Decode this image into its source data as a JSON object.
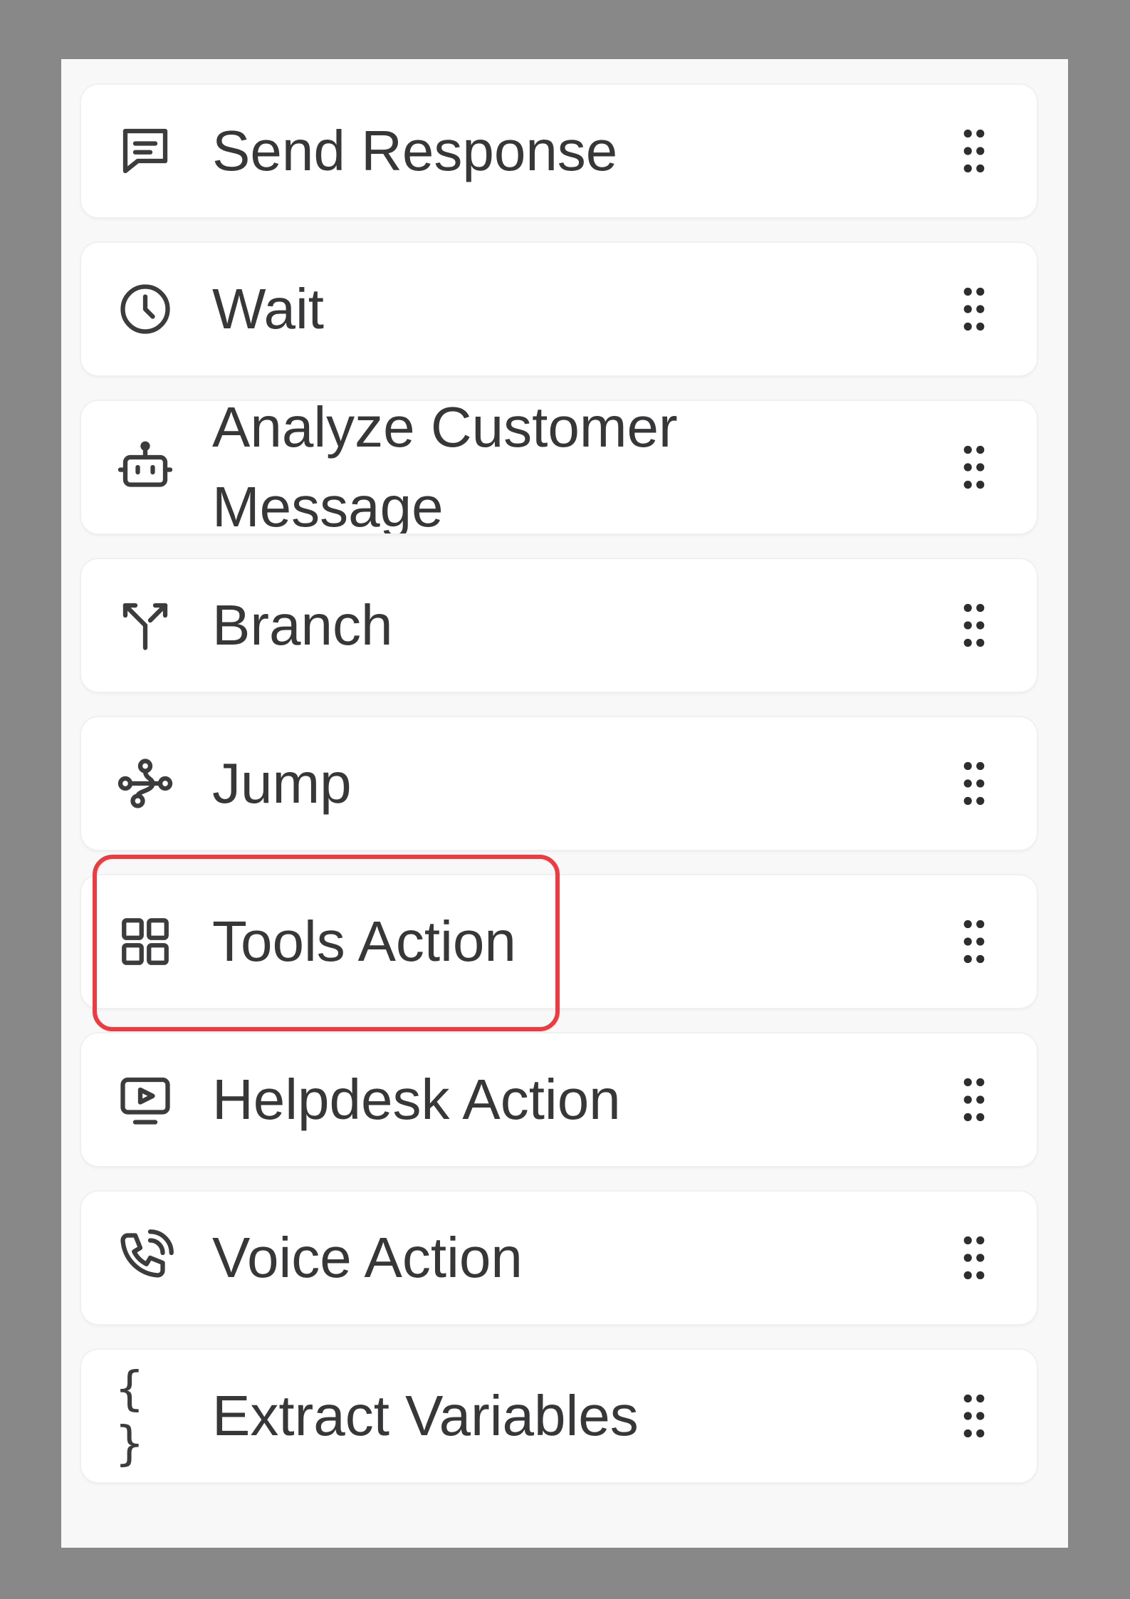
{
  "actions": [
    {
      "label": "Send Response",
      "icon": "message-square-icon"
    },
    {
      "label": "Wait",
      "icon": "clock-icon"
    },
    {
      "label": "Analyze Customer Message",
      "icon": "bot-icon"
    },
    {
      "label": "Branch",
      "icon": "split-icon"
    },
    {
      "label": "Jump",
      "icon": "workflow-icon"
    },
    {
      "label": "Tools Action",
      "icon": "grid-icon"
    },
    {
      "label": "Helpdesk Action",
      "icon": "monitor-play-icon"
    },
    {
      "label": "Voice Action",
      "icon": "phone-call-icon"
    },
    {
      "label": "Extract Variables",
      "icon": "braces-icon"
    }
  ],
  "braces_glyph": "{ }",
  "highlight_color": "#ef3a3f"
}
